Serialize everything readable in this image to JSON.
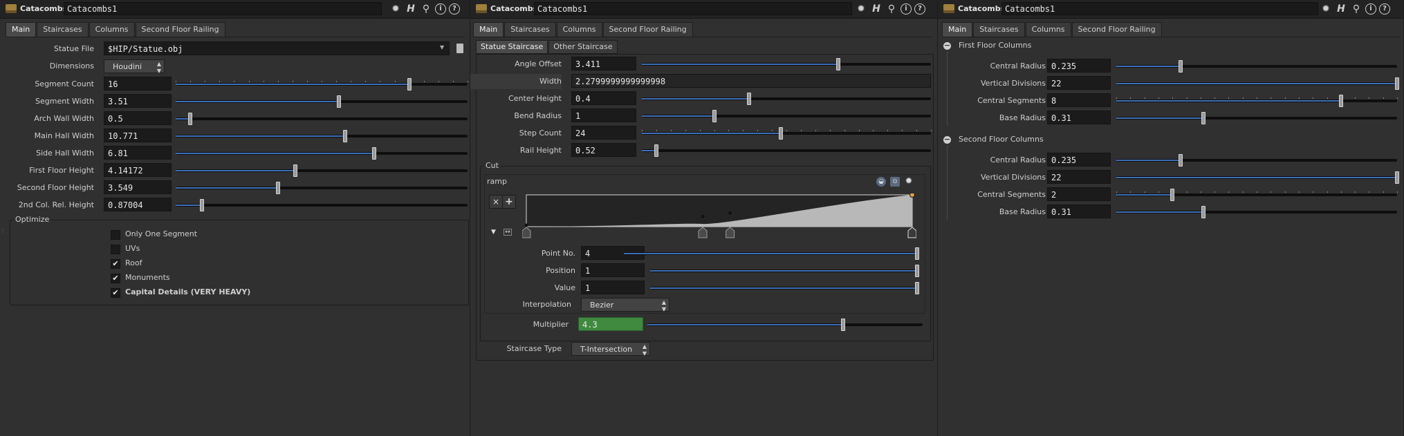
{
  "panels": [
    {
      "node_type": "Catacombs",
      "node_name": "Catacombs1",
      "tabs": [
        "Main",
        "Staircases",
        "Columns",
        "Second Floor Railing"
      ],
      "active_tab": 0
    },
    {
      "node_type": "Catacombs",
      "node_name": "Catacombs1",
      "tabs": [
        "Main",
        "Staircases",
        "Columns",
        "Second Floor Railing"
      ],
      "active_tab": 0
    },
    {
      "node_type": "Catacombs",
      "node_name": "Catacombs1",
      "tabs": [
        "Main",
        "Staircases",
        "Columns",
        "Second Floor Railing"
      ],
      "active_tab": 0
    }
  ],
  "toolbar_icons": [
    "gear-icon",
    "help-h-icon",
    "search-icon",
    "info-icon",
    "question-icon"
  ],
  "left": {
    "statue_file": {
      "label": "Statue File",
      "value": "$HIP/Statue.obj"
    },
    "dimensions": {
      "label": "Dimensions",
      "value": "Houdini"
    },
    "params": [
      {
        "label": "Segment Count",
        "value": "16",
        "fraction": 0.8,
        "ticks": true
      },
      {
        "label": "Segment Width",
        "value": "3.51",
        "fraction": 0.56
      },
      {
        "label": "Arch Wall Width",
        "value": "0.5",
        "fraction": 0.05
      },
      {
        "label": "Main Hall Width",
        "value": "10.771",
        "fraction": 0.58
      },
      {
        "label": "Side Hall Width",
        "value": "6.81",
        "fraction": 0.68
      },
      {
        "label": "First Floor Height",
        "value": "4.14172",
        "fraction": 0.41
      },
      {
        "label": "Second Floor Height",
        "value": "3.549",
        "fraction": 0.35
      },
      {
        "label": "2nd Col. Rel. Height",
        "value": "0.87004",
        "fraction": 0.09
      }
    ],
    "optimize": {
      "title": "Optimize",
      "items": [
        {
          "label": "Only One Segment",
          "checked": false
        },
        {
          "label": "UVs",
          "checked": false
        },
        {
          "label": "Roof",
          "checked": true
        },
        {
          "label": "Monuments",
          "checked": true
        },
        {
          "label": "Capital Details (VERY HEAVY)",
          "checked": true
        }
      ]
    }
  },
  "middle": {
    "sub_tabs": [
      "Statue Staircase",
      "Other Staircase"
    ],
    "params": [
      {
        "label": "Angle Offset",
        "value": "3.411",
        "fraction": 0.68
      },
      {
        "label": "Width",
        "value": "2.2799999999999998",
        "fraction": null
      },
      {
        "label": "Center Height",
        "value": "0.4",
        "fraction": 0.37
      },
      {
        "label": "Bend Radius",
        "value": "1",
        "fraction": 0.25
      },
      {
        "label": "Step Count",
        "value": "24",
        "fraction": 0.48,
        "ticks": true
      },
      {
        "label": "Rail Height",
        "value": "0.52",
        "fraction": 0.05
      }
    ],
    "cut": {
      "title": "Cut",
      "ramp_label": "ramp",
      "ramp_points": [
        [
          0.0,
          0.0
        ],
        [
          0.457,
          0.19
        ],
        [
          0.528,
          0.43
        ],
        [
          1.0,
          1.0
        ]
      ],
      "point_no": {
        "label": "Point No.",
        "value": "4"
      },
      "position": {
        "label": "Position",
        "value": "1"
      },
      "value": {
        "label": "Value",
        "value": "1"
      },
      "interpolation": {
        "label": "Interpolation",
        "value": "Bezier"
      },
      "multiplier": {
        "label": "Multiplier",
        "value": "4.3",
        "fraction": 0.71
      }
    },
    "staircase_type": {
      "label": "Staircase Type",
      "value": "T-Intersection"
    }
  },
  "right": {
    "sections": [
      {
        "title": "First Floor Columns",
        "params": [
          {
            "label": "Central Radius",
            "value": "0.235",
            "fraction": 0.23
          },
          {
            "label": "Vertical Divisions",
            "value": "22",
            "fraction": 1.0
          },
          {
            "label": "Central Segments",
            "value": "8",
            "fraction": 0.8,
            "ticks": true
          },
          {
            "label": "Base Radius",
            "value": "0.31",
            "fraction": 0.31
          }
        ]
      },
      {
        "title": "Second Floor Columns",
        "params": [
          {
            "label": "Central Radius",
            "value": "0.235",
            "fraction": 0.23
          },
          {
            "label": "Vertical Divisions",
            "value": "22",
            "fraction": 1.0
          },
          {
            "label": "Central Segments",
            "value": "2",
            "fraction": 0.2,
            "ticks": true
          },
          {
            "label": "Base Radius",
            "value": "0.31",
            "fraction": 0.31
          }
        ]
      }
    ]
  },
  "colors": {
    "slider_fill": "#3d6fb8",
    "multiplier_bg": "#3f8a3f",
    "ramp_fill": "#b8b8b8"
  }
}
